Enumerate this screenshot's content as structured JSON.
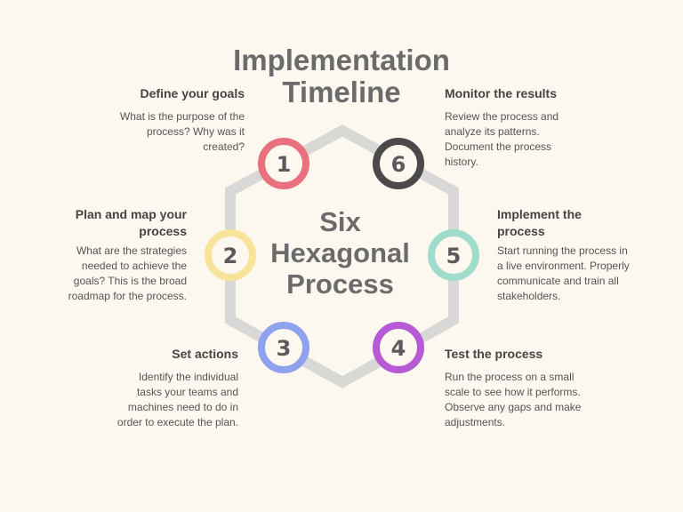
{
  "title": "Implementation Timeline",
  "center_label": "Six Hexagonal Process",
  "colors": {
    "background": "#fcf7ef",
    "hexagon": "#d8d8d6"
  },
  "steps": [
    {
      "number": "1",
      "heading": "Define your goals",
      "text": "What is the purpose of the process? Why was it created?",
      "color": "#e8707f"
    },
    {
      "number": "2",
      "heading": "Plan and map your process",
      "text": "What are the strategies needed to achieve the goals? This is the broad roadmap for the process.",
      "color": "#f7e49a"
    },
    {
      "number": "3",
      "heading": "Set actions",
      "text": "Identify the individual tasks your teams and machines need to do in order to execute the plan.",
      "color": "#8fa2ee"
    },
    {
      "number": "4",
      "heading": "Test the process",
      "text": "Run the process on a small scale to see how it performs. Observe any gaps and make adjustments.",
      "color": "#b65ad6"
    },
    {
      "number": "5",
      "heading": "Implement the process",
      "text": "Start running the process in a live environment. Properly communicate and train all stakeholders.",
      "color": "#9fdccb"
    },
    {
      "number": "6",
      "heading": "Monitor the results",
      "text": "Review the process and analyze its patterns. Document the process history.",
      "color": "#4a4a4a"
    }
  ]
}
